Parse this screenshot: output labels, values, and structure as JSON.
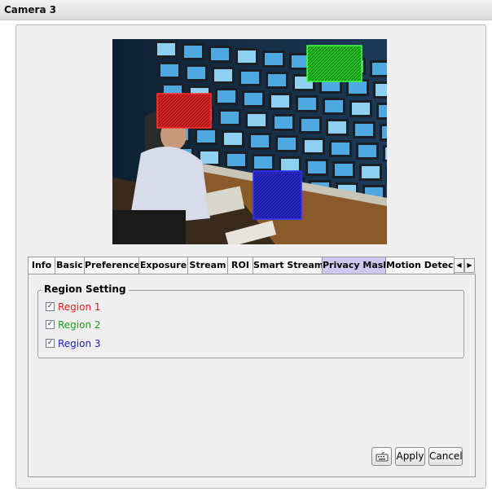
{
  "window": {
    "title": "Camera 3"
  },
  "tabs": [
    {
      "label": "Info"
    },
    {
      "label": "Basic"
    },
    {
      "label": "Preference"
    },
    {
      "label": "Exposure"
    },
    {
      "label": "Stream"
    },
    {
      "label": "ROI"
    },
    {
      "label": "Smart Stream"
    },
    {
      "label": "Privacy Mask",
      "active": true
    },
    {
      "label": "Motion Detecti"
    }
  ],
  "region_setting": {
    "title": "Region Setting",
    "regions": [
      {
        "label": "Region 1",
        "checked": true,
        "color": "#e02020"
      },
      {
        "label": "Region 2",
        "checked": true,
        "color": "#20a020"
      },
      {
        "label": "Region 3",
        "checked": true,
        "color": "#2020c0"
      }
    ]
  },
  "buttons": {
    "apply_label": "Apply",
    "cancel_label": "Cancel"
  },
  "icons": {
    "tab_left": "chevron-left-icon",
    "tab_right": "chevron-right-icon",
    "keyboard": "keyboard-icon"
  },
  "colors": {
    "active_tab": "#cfc7f0",
    "mask_red": "#e02020",
    "mask_green": "#20c020",
    "mask_blue": "#2020c0"
  }
}
